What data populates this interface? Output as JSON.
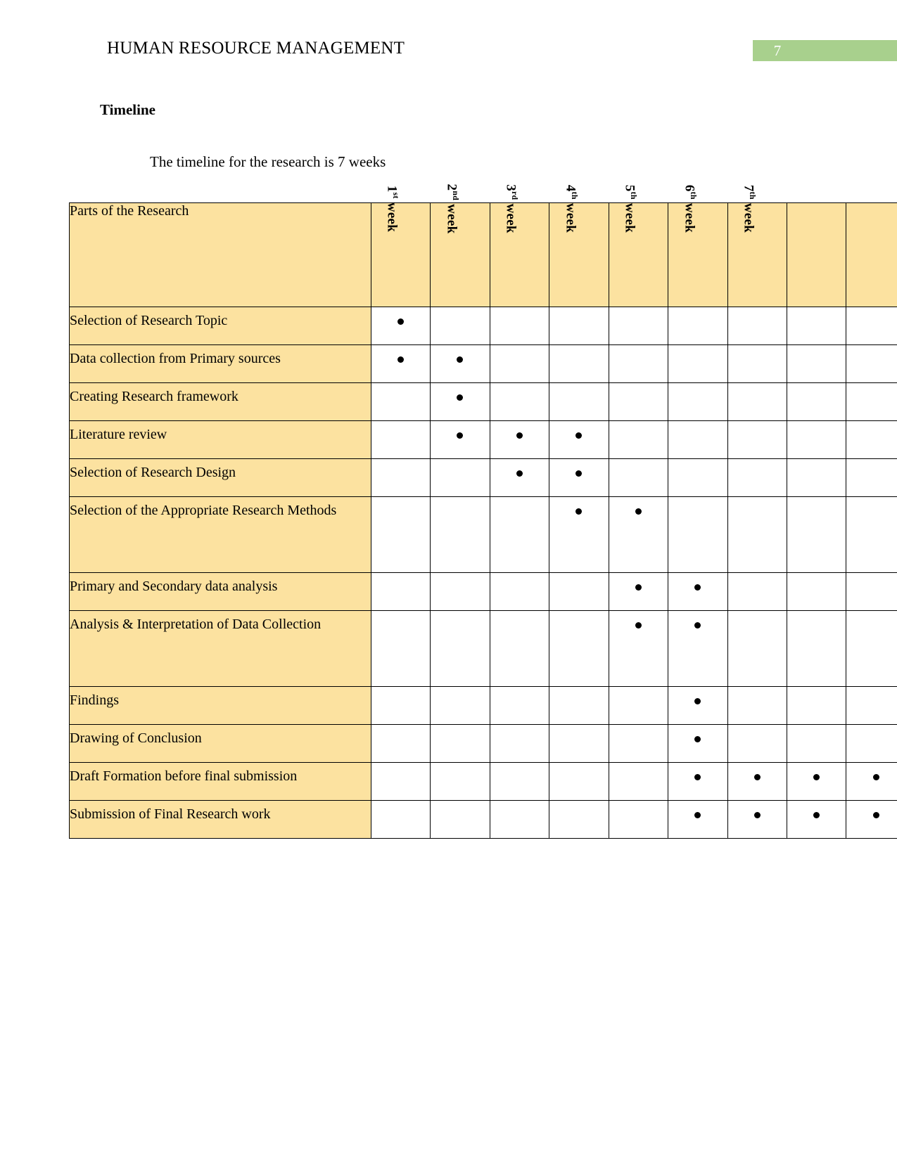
{
  "header": {
    "document_title": "HUMAN RESOURCE MANAGEMENT",
    "page_number": "7",
    "band_color": "#a8d08d"
  },
  "section": {
    "heading": "Timeline",
    "intro": "The timeline for the research is 7 weeks"
  },
  "table": {
    "first_column_header": "Parts of the Research",
    "header_fill": "#fce2a0",
    "week_headers": [
      {
        "ordinal": "1",
        "suffix": "st",
        "unit": "week",
        "full": "1st week"
      },
      {
        "ordinal": "2",
        "suffix": "nd",
        "unit": "week",
        "full": "2nd week"
      },
      {
        "ordinal": "3",
        "suffix": "rd",
        "unit": "week",
        "full": "3rd week"
      },
      {
        "ordinal": "4",
        "suffix": "th",
        "unit": "week",
        "full": "4th week"
      },
      {
        "ordinal": "5",
        "suffix": "th",
        "unit": "week",
        "full": "5th week"
      },
      {
        "ordinal": "6",
        "suffix": "th",
        "unit": "week",
        "full": "6th week"
      },
      {
        "ordinal": "7",
        "suffix": "th",
        "unit": "week",
        "full": "7th week"
      },
      {
        "ordinal": "",
        "suffix": "",
        "unit": "",
        "full": ""
      },
      {
        "ordinal": "",
        "suffix": "",
        "unit": "",
        "full": ""
      }
    ],
    "rows": [
      {
        "task": "Selection of Research Topic",
        "marks": [
          1,
          0,
          0,
          0,
          0,
          0,
          0,
          0,
          0
        ],
        "lines": 1
      },
      {
        "task": "Data collection from Primary sources",
        "marks": [
          1,
          1,
          0,
          0,
          0,
          0,
          0,
          0,
          0
        ],
        "lines": 1
      },
      {
        "task": "Creating Research framework",
        "marks": [
          0,
          1,
          0,
          0,
          0,
          0,
          0,
          0,
          0
        ],
        "lines": 1
      },
      {
        "task": "Literature review",
        "marks": [
          0,
          1,
          1,
          1,
          0,
          0,
          0,
          0,
          0
        ],
        "lines": 1
      },
      {
        "task": "Selection of Research Design",
        "marks": [
          0,
          0,
          1,
          1,
          0,
          0,
          0,
          0,
          0
        ],
        "lines": 1
      },
      {
        "task": "Selection of the Appropriate Research Methods",
        "marks": [
          0,
          0,
          0,
          1,
          1,
          0,
          0,
          0,
          0
        ],
        "lines": 2
      },
      {
        "task": "Primary and Secondary data analysis",
        "marks": [
          0,
          0,
          0,
          0,
          1,
          1,
          0,
          0,
          0
        ],
        "lines": 1
      },
      {
        "task": "Analysis & Interpretation of Data Collection",
        "marks": [
          0,
          0,
          0,
          0,
          1,
          1,
          0,
          0,
          0
        ],
        "lines": 2
      },
      {
        "task": "Findings",
        "marks": [
          0,
          0,
          0,
          0,
          0,
          1,
          0,
          0,
          0
        ],
        "lines": 1
      },
      {
        "task": "Drawing of Conclusion",
        "marks": [
          0,
          0,
          0,
          0,
          0,
          1,
          0,
          0,
          0
        ],
        "lines": 1
      },
      {
        "task": "Draft Formation before final submission",
        "marks": [
          0,
          0,
          0,
          0,
          0,
          1,
          1,
          1,
          1
        ],
        "lines": 1
      },
      {
        "task": "Submission of Final Research work",
        "marks": [
          0,
          0,
          0,
          0,
          0,
          1,
          1,
          1,
          1
        ],
        "lines": 1
      }
    ]
  }
}
